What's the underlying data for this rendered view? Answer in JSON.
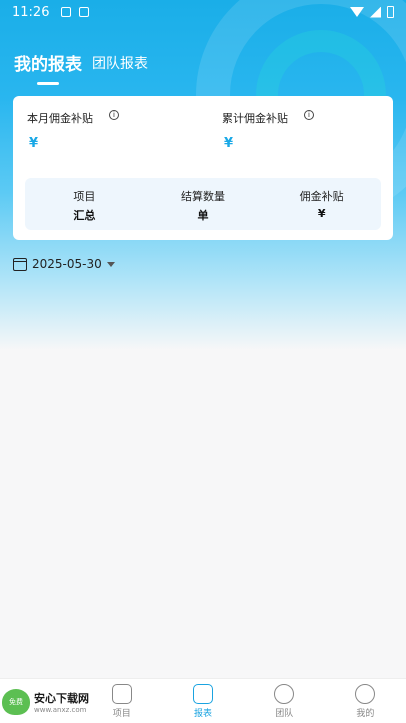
{
  "status": {
    "time": "11:26"
  },
  "tabs": {
    "active": "我的报表",
    "inactive": "团队报表"
  },
  "card": {
    "month_label": "本月佣金补贴",
    "month_value": "¥",
    "total_label": "累计佣金补贴",
    "total_value": "¥",
    "info_glyph": "i",
    "summary": {
      "headers": [
        "项目",
        "结算数量",
        "佣金补贴"
      ],
      "values": [
        "汇总",
        "单",
        "¥"
      ]
    }
  },
  "date": {
    "value": "2025-05-30"
  },
  "nav": [
    {
      "label": "项目",
      "icon": "folder-icon"
    },
    {
      "label": "报表",
      "icon": "chart-icon",
      "active": true
    },
    {
      "label": "团队",
      "icon": "team-icon"
    },
    {
      "label": "我的",
      "icon": "user-icon"
    }
  ],
  "watermark": {
    "brand": "安心下载网",
    "url": "www.anxz.com",
    "tag": "免费"
  },
  "colors": {
    "accent": "#1aa3e0",
    "amount": "#19a8e6"
  }
}
